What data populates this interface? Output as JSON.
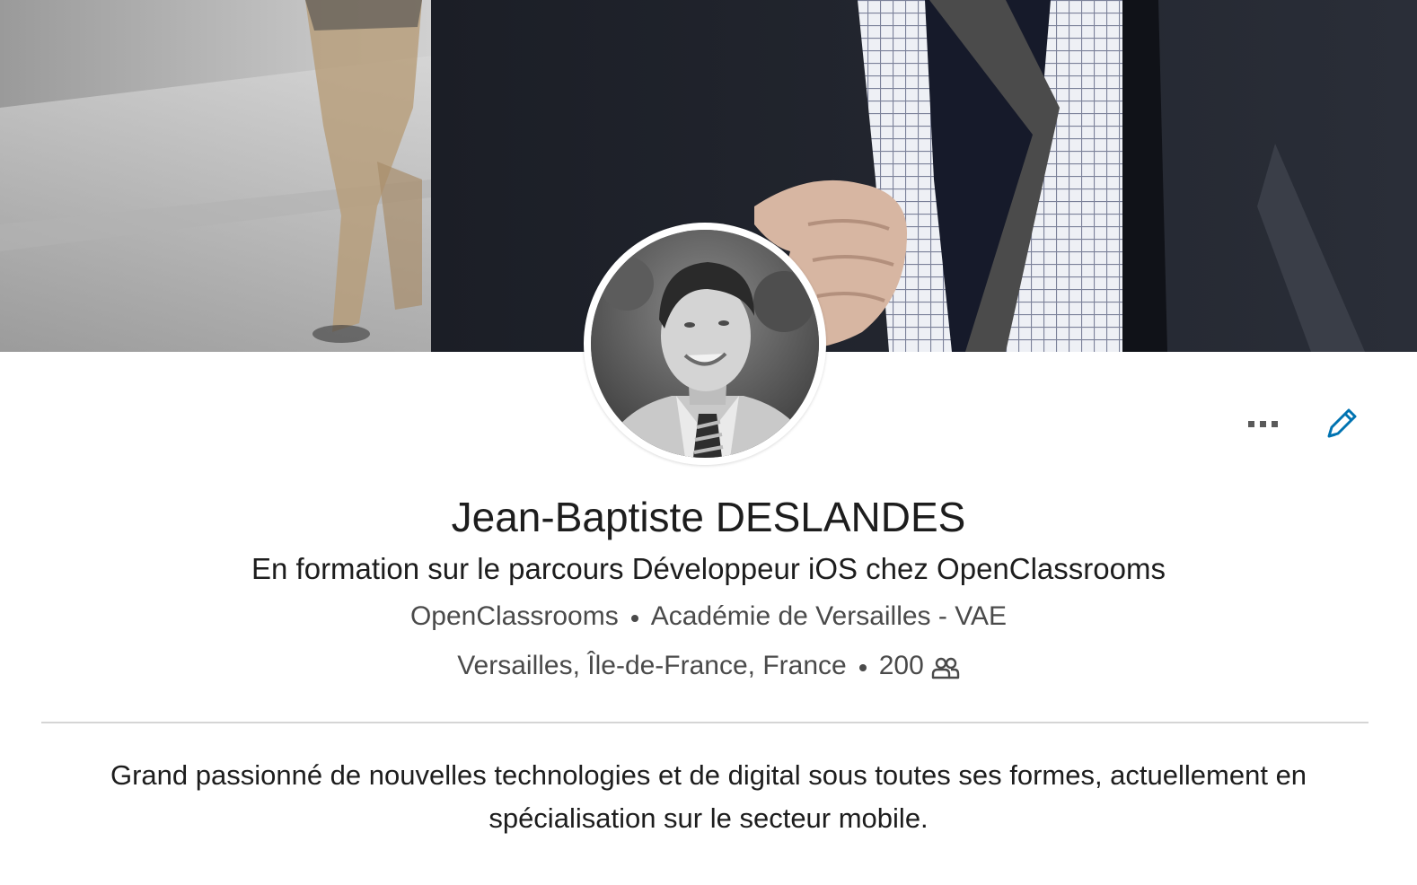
{
  "profile": {
    "name": "Jean-Baptiste DESLANDES",
    "headline": "En formation sur le parcours Développeur iOS chez OpenClassrooms",
    "company": "OpenClassrooms",
    "education": "Académie de Versailles - VAE",
    "location": "Versailles, Île-de-France, France",
    "connections": "200",
    "summary": "Grand passionné de nouvelles technologies et de digital sous toutes ses formes, actuellement en spécialisation sur le secteur mobile."
  },
  "icons": {
    "more": "more-horizontal-icon",
    "edit": "pencil-icon",
    "connections": "people-icon"
  },
  "colors": {
    "accent": "#0073b1",
    "text": "#1d1d1d",
    "muted": "#4a4a4a",
    "divider": "#d5d5d5"
  }
}
